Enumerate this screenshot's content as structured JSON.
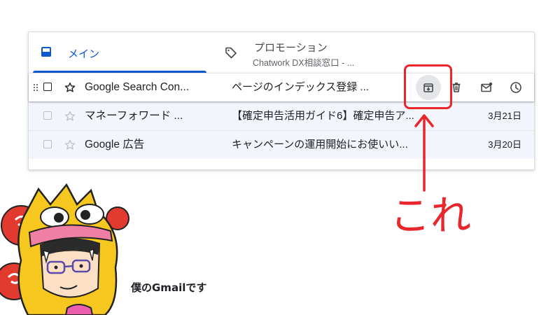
{
  "tabs": {
    "main": {
      "label": "メイン"
    },
    "promotions": {
      "label": "プロモーション",
      "preview": "Chatwork DX相談窓口 - ..."
    }
  },
  "emails": [
    {
      "sender": "Google Search Con...",
      "subject": "ページのインデックス登録 ...",
      "date": "",
      "hovered": true
    },
    {
      "sender": "マネーフォワード ...",
      "subject": "【確定申告活用ガイド6】確定申告ア...",
      "date": "3月21日"
    },
    {
      "sender": "Google 広告",
      "subject": "キャンペーンの運用開始にお使いい...",
      "date": "3月20日"
    }
  ],
  "row_actions": [
    "archive-icon",
    "trash-icon",
    "mark-unread-icon",
    "snooze-icon"
  ],
  "annotation": {
    "label": "これ",
    "color": "#e8262c"
  },
  "caption": "僕のGmailです",
  "colors": {
    "accent": "#0b57d0",
    "row_bg": "#f2f6fc",
    "annotation": "#e8262c"
  }
}
